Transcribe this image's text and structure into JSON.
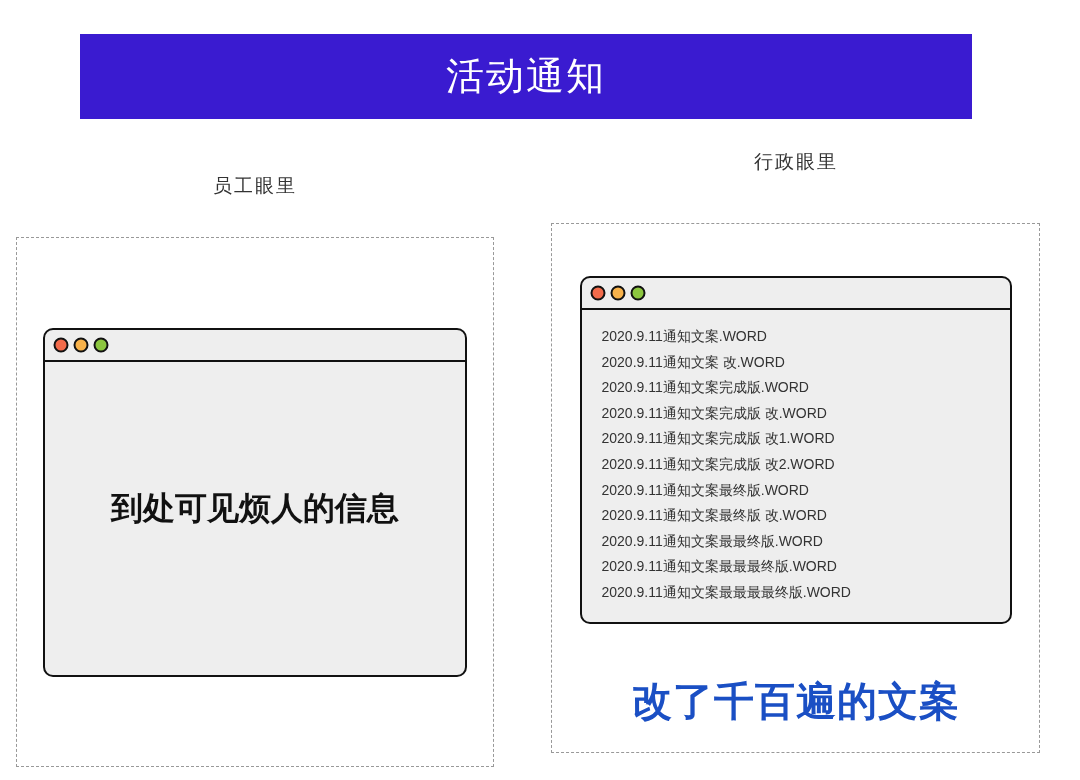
{
  "banner": {
    "title": "活动通知"
  },
  "panels": [
    {
      "kind": "message",
      "caption": "员工眼里",
      "message": "到处可见烦人的信息"
    },
    {
      "kind": "files",
      "caption": "行政眼里",
      "files": [
        "2020.9.11通知文案.WORD",
        "2020.9.11通知文案 改.WORD",
        "2020.9.11通知文案完成版.WORD",
        "2020.9.11通知文案完成版 改.WORD",
        "2020.9.11通知文案完成版 改1.WORD",
        "2020.9.11通知文案完成版 改2.WORD",
        "2020.9.11通知文案最终版.WORD",
        "2020.9.11通知文案最终版 改.WORD",
        "2020.9.11通知文案最最终版.WORD",
        "2020.9.11通知文案最最最终版.WORD",
        "2020.9.11通知文案最最最最终版.WORD"
      ],
      "slogan": "改了千百遍的文案"
    }
  ]
}
